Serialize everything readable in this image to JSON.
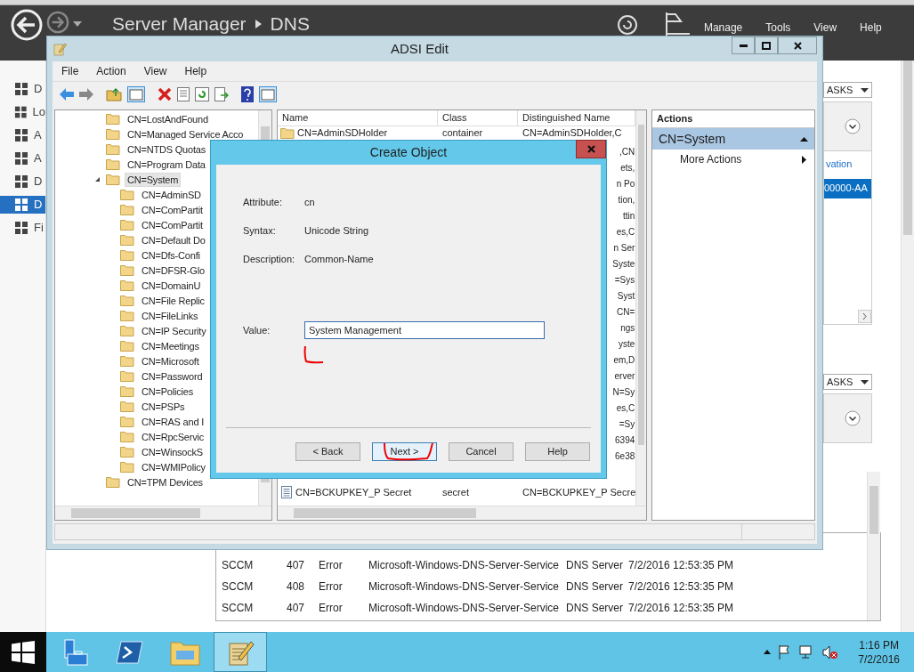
{
  "server_manager": {
    "title": "Server Manager",
    "page": "DNS",
    "menu": [
      "Manage",
      "Tools",
      "View",
      "Help"
    ],
    "nav": [
      {
        "label": "D",
        "selected": false
      },
      {
        "label": "Lo",
        "selected": false
      },
      {
        "label": "A",
        "selected": false
      },
      {
        "label": "A",
        "selected": false
      },
      {
        "label": "D",
        "selected": false
      },
      {
        "label": "D",
        "selected": true
      },
      {
        "label": "Fi",
        "selected": false
      }
    ],
    "tasks": [
      "ASKS",
      "ASKS"
    ],
    "link": "vation",
    "selected_row": "00000-AA",
    "events": [
      {
        "server": "SCCM",
        "id": "407",
        "severity": "Error",
        "source": "Microsoft-Windows-DNS-Server-Service",
        "log": "DNS Server",
        "date": "7/2/2016 12:53:35 PM"
      },
      {
        "server": "SCCM",
        "id": "408",
        "severity": "Error",
        "source": "Microsoft-Windows-DNS-Server-Service",
        "log": "DNS Server",
        "date": "7/2/2016 12:53:35 PM"
      },
      {
        "server": "SCCM",
        "id": "407",
        "severity": "Error",
        "source": "Microsoft-Windows-DNS-Server-Service",
        "log": "DNS Server",
        "date": "7/2/2016 12:53:35 PM"
      }
    ]
  },
  "adsi": {
    "title": "ADSI Edit",
    "menu": [
      "File",
      "Action",
      "View",
      "Help"
    ],
    "tree": [
      {
        "label": "CN=LostAndFound",
        "selected": false
      },
      {
        "label": "CN=Managed Service Acco",
        "selected": false
      },
      {
        "label": "CN=NTDS Quotas",
        "selected": false
      },
      {
        "label": "CN=Program Data",
        "selected": false
      },
      {
        "label": "CN=System",
        "selected": true,
        "expanded": true,
        "children": [
          {
            "label": "CN=AdminSD",
            "selected": false
          },
          {
            "label": "CN=ComPartit",
            "selected": false
          },
          {
            "label": "CN=ComPartit",
            "selected": false
          },
          {
            "label": "CN=Default Do",
            "selected": false
          },
          {
            "label": "CN=Dfs-Confi",
            "selected": false
          },
          {
            "label": "CN=DFSR-Glo",
            "selected": false
          },
          {
            "label": "CN=DomainU",
            "selected": false
          },
          {
            "label": "CN=File Replic",
            "selected": false
          },
          {
            "label": "CN=FileLinks",
            "selected": false
          },
          {
            "label": "CN=IP Security",
            "selected": false
          },
          {
            "label": "CN=Meetings",
            "selected": false
          },
          {
            "label": "CN=Microsoft",
            "selected": false
          },
          {
            "label": "CN=Password",
            "selected": false
          },
          {
            "label": "CN=Policies",
            "selected": false
          },
          {
            "label": "CN=PSPs",
            "selected": false
          },
          {
            "label": "CN=RAS and I",
            "selected": false
          },
          {
            "label": "CN=RpcServic",
            "selected": false
          },
          {
            "label": "CN=WinsockS",
            "selected": false
          },
          {
            "label": "CN=WMIPolicy",
            "selected": false
          }
        ]
      },
      {
        "label": "CN=TPM Devices",
        "selected": false
      }
    ],
    "list": {
      "columns": [
        "Name",
        "Class",
        "Distinguished Name"
      ],
      "rows_above": [
        {
          "name": "CN=AdminSDHolder",
          "class": "container",
          "dn": "CN=AdminSDHolder,C"
        }
      ],
      "dn_fragments": [
        ",CN",
        "ets,",
        "n Po",
        "tion,",
        "ttin",
        "es,C",
        "n Ser",
        "Syste",
        "=Sys",
        "Syst",
        "CN=",
        "ngs",
        "yste",
        "em,D",
        "erver",
        "N=Sy",
        "es,C",
        "=Sy",
        "6394",
        "6e38"
      ],
      "rows_below": [
        {
          "name": "CN=BCKUPKEY_P Secret",
          "class": "secret",
          "dn": "CN=BCKUPKEY_P Secre"
        }
      ]
    },
    "actions": {
      "title": "Actions",
      "group": "CN=System",
      "items": [
        "More Actions"
      ]
    }
  },
  "dialog": {
    "title": "Create Object",
    "fields": [
      {
        "label": "Attribute:",
        "value": "cn"
      },
      {
        "label": "Syntax:",
        "value": "Unicode String"
      },
      {
        "label": "Description:",
        "value": "Common-Name"
      }
    ],
    "value_label": "Value:",
    "value": "System Management",
    "buttons": [
      {
        "label": "< Back",
        "focused": false
      },
      {
        "label": "Next >",
        "focused": true
      },
      {
        "label": "Cancel",
        "focused": false
      },
      {
        "label": "Help",
        "focused": false
      }
    ]
  },
  "taskbar": {
    "apps": [
      {
        "kind": "server-manager",
        "selected": false
      },
      {
        "kind": "powershell",
        "selected": false
      },
      {
        "kind": "explorer",
        "selected": false
      },
      {
        "kind": "adsi-edit",
        "selected": true
      }
    ],
    "time": "1:16 PM",
    "date": "7/2/2016"
  }
}
